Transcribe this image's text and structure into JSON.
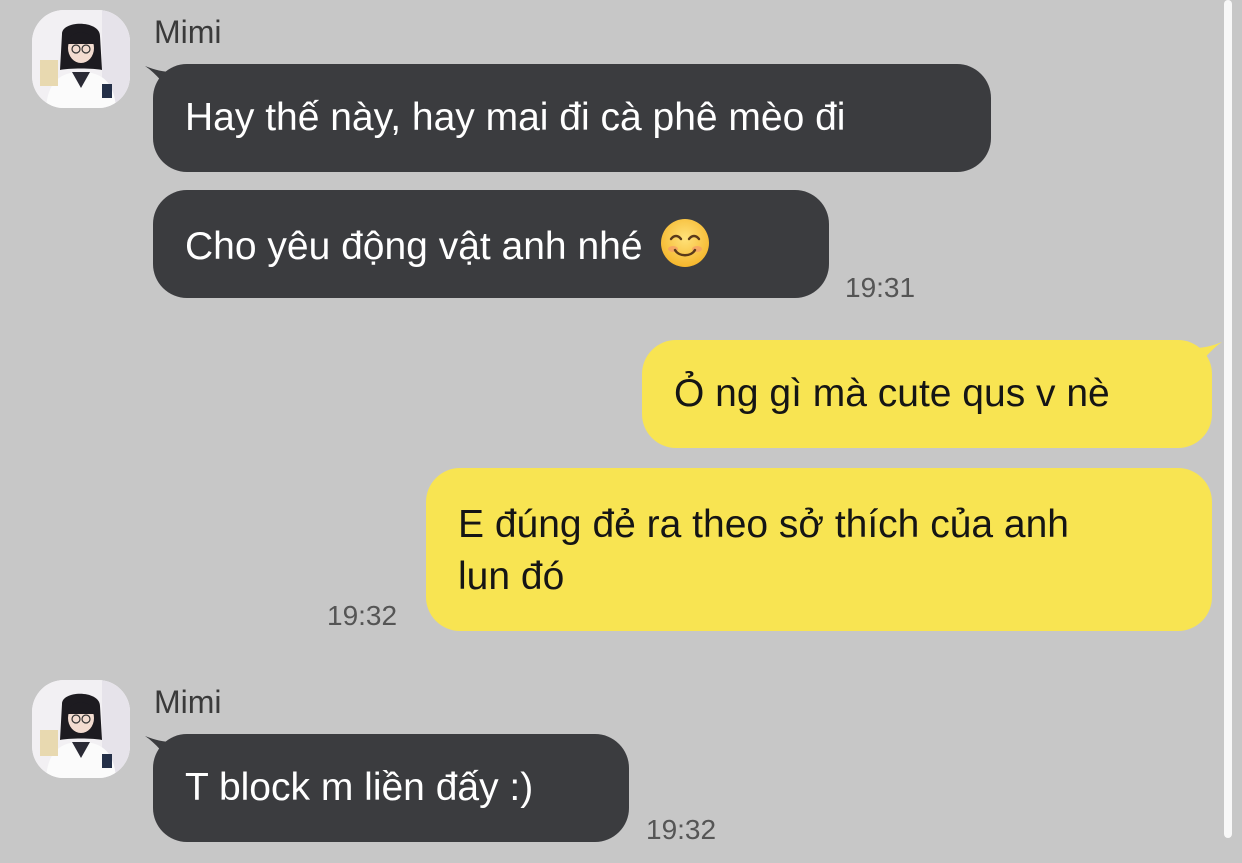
{
  "conversation": {
    "group1": {
      "sender": "Mimi",
      "messages": [
        "Hay thế này, hay mai đi cà phê mèo đi",
        "Cho yêu động vật anh nhé"
      ],
      "emoji": "smiling-face-icon",
      "time": "19:31"
    },
    "outgoing": {
      "messages": [
        "Ỏ ng gì mà cute qus v nè",
        "E đúng đẻ ra theo sở thích của anh",
        "lun đó"
      ],
      "time": "19:32"
    },
    "group2": {
      "sender": "Mimi",
      "messages": [
        "T block m liền đấy :)"
      ],
      "time": "19:32"
    }
  },
  "colors": {
    "background": "#c7c7c7",
    "incoming_bubble": "#3b3c3f",
    "outgoing_bubble": "#f8e452"
  }
}
